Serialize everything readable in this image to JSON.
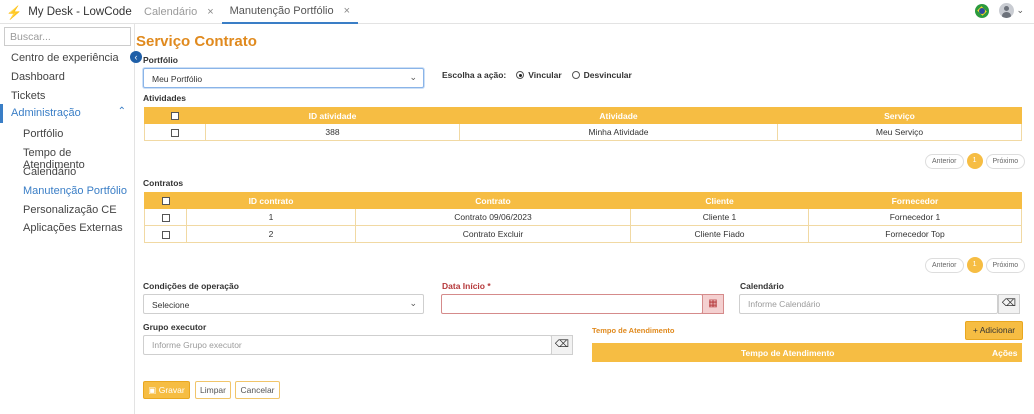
{
  "app": {
    "title": "My Desk - LowCode",
    "logo_icon": "⚡"
  },
  "tabs": [
    {
      "label": "Calendário",
      "close": "×"
    },
    {
      "label": "Manutenção Portfólio",
      "close": "×"
    }
  ],
  "sidebar": {
    "search_placeholder": "Buscar...",
    "items": [
      "Centro de experiência",
      "Dashboard",
      "Tickets"
    ],
    "group": {
      "label": "Administração",
      "chev": "⌃"
    },
    "subitems": [
      "Portfólio",
      "Tempo de Atendimento",
      "Calendário",
      "Manutenção Portfólio",
      "Personalização CE",
      "Aplicações Externas"
    ]
  },
  "page": {
    "title": "Serviço Contrato"
  },
  "portfolio": {
    "label": "Portfólio",
    "value": "Meu Portfólio"
  },
  "acao": {
    "label": "Escolha a ação:",
    "options": [
      "Vincular",
      "Desvincular"
    ],
    "selected": "Vincular"
  },
  "atividades": {
    "label": "Atividades",
    "columns": [
      "ID atividade",
      "Atividade",
      "Serviço"
    ],
    "rows": [
      [
        "388",
        "Minha Atividade",
        "Meu Serviço"
      ]
    ],
    "pager": {
      "prev": "Anterior",
      "page": "1",
      "next": "Próximo"
    }
  },
  "contratos": {
    "label": "Contratos",
    "columns": [
      "ID contrato",
      "Contrato",
      "Cliente",
      "Fornecedor"
    ],
    "rows": [
      [
        "1",
        "Contrato 09/06/2023",
        "Cliente 1",
        "Fornecedor 1"
      ],
      [
        "2",
        "Contrato Excluir",
        "Cliente Fiado",
        "Fornecedor Top"
      ]
    ],
    "pager": {
      "prev": "Anterior",
      "page": "1",
      "next": "Próximo"
    }
  },
  "form": {
    "condicoes": {
      "label": "Condições de operação",
      "value": "Selecione"
    },
    "data_inicio": {
      "label": "Data Início *",
      "value": ""
    },
    "calendario": {
      "label": "Calendário",
      "placeholder": "Informe Calendário"
    },
    "grupo": {
      "label": "Grupo executor",
      "placeholder": "Informe Grupo executor"
    },
    "tempo": {
      "label": "Tempo de Atendimento",
      "add_label": "+ Adicionar",
      "columns": [
        "Tempo de Atendimento",
        "Ações"
      ]
    }
  },
  "actions": {
    "save": "Gravar",
    "clear": "Limpar",
    "cancel": "Cancelar"
  },
  "colors": {
    "accent": "#f6bd43",
    "title": "#e08a1e",
    "link": "#3a7ec6"
  }
}
